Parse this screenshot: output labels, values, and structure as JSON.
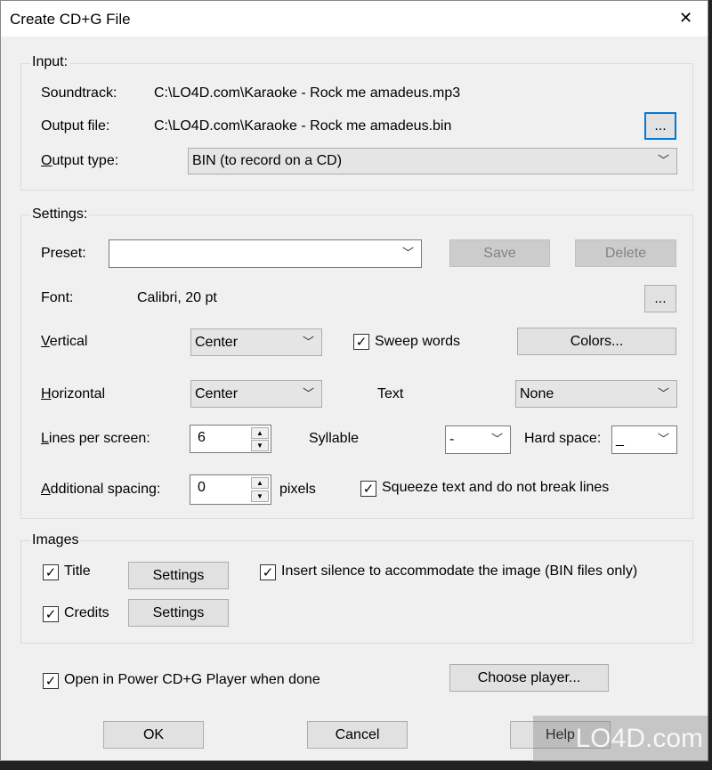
{
  "window": {
    "title": "Create CD+G File",
    "close": "✕"
  },
  "input": {
    "label": "Input:",
    "soundtrack_label": "Soundtrack:",
    "soundtrack": "C:\\LO4D.com\\Karaoke - Rock me amadeus.mp3",
    "output_file_label": "Output file:",
    "output_file": "C:\\LO4D.com\\Karaoke - Rock me amadeus.bin",
    "browse": "...",
    "output_type_label": "Output type:",
    "output_type": "BIN (to record on a CD)"
  },
  "settings": {
    "label": "Settings:",
    "preset_label": "Preset:",
    "preset": "",
    "save": "Save",
    "delete": "Delete",
    "font_label": "Font:",
    "font": "Calibri, 20 pt",
    "font_button": "...",
    "vertical_label": "Vertical",
    "vertical": "Center",
    "sweep_words": "Sweep words",
    "sweep_checked": true,
    "colors": "Colors...",
    "horizontal_label": "Horizontal",
    "horizontal": "Center",
    "text_label": "Text",
    "text": "None",
    "lines_label": "Lines per screen:",
    "lines": "6",
    "syllable_label": "Syllable",
    "syllable": "-",
    "hard_space_label": "Hard space:",
    "hard_space": "_",
    "spacing_label": "Additional spacing:",
    "spacing": "0",
    "pixels": "pixels",
    "squeeze": "Squeeze text and do not break lines",
    "squeeze_checked": true
  },
  "images": {
    "label": "Images",
    "title": "Title",
    "title_checked": true,
    "credits": "Credits",
    "credits_checked": true,
    "settings": "Settings",
    "insert_silence": "Insert silence to accommodate the image (BIN files only)",
    "insert_checked": true
  },
  "open_player": "Open in Power CD+G Player when done",
  "open_checked": true,
  "choose_player": "Choose player...",
  "buttons": {
    "ok": "OK",
    "cancel": "Cancel",
    "help": "Help"
  },
  "watermark": "LO4D.com"
}
